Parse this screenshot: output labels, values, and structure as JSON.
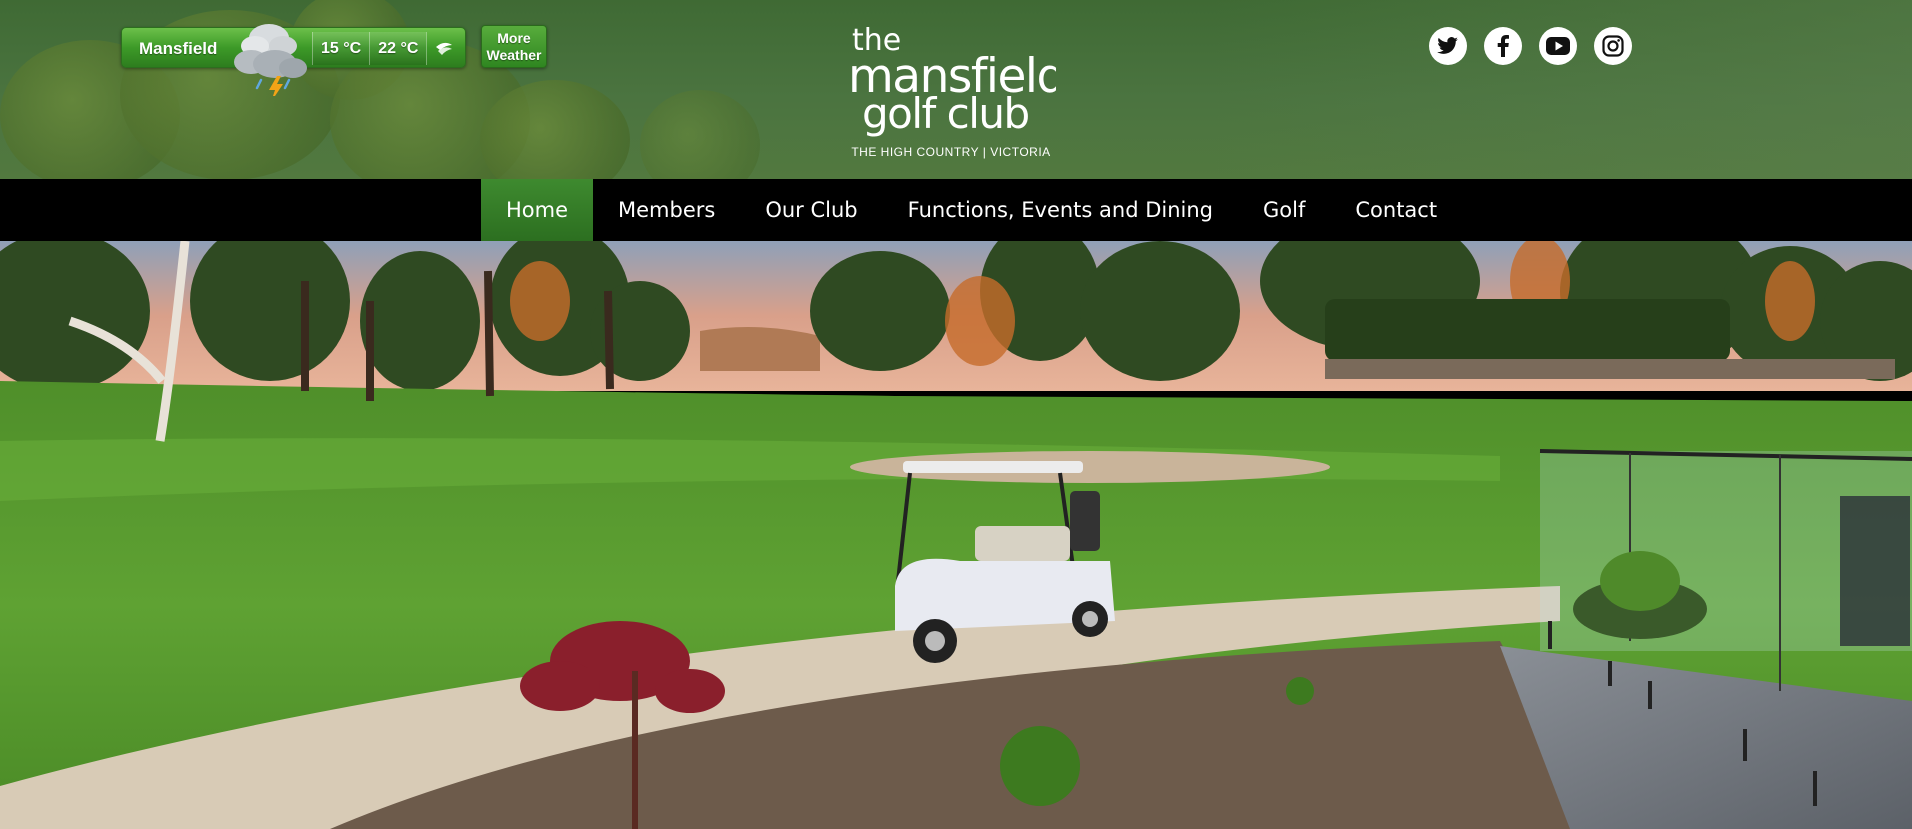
{
  "weather": {
    "location": "Mansfield",
    "min_temp": "15 °C",
    "max_temp": "22 °C",
    "condition_icon": "storm-cloud-icon",
    "more_label_line1": "More",
    "more_label_line2": "Weather"
  },
  "logo": {
    "line1": "the",
    "line2": "mansfield",
    "line3": "golf club",
    "tagline": "THE HIGH COUNTRY | VICTORIA"
  },
  "social": [
    {
      "icon": "twitter-icon"
    },
    {
      "icon": "facebook-icon"
    },
    {
      "icon": "youtube-icon"
    },
    {
      "icon": "instagram-icon"
    }
  ],
  "nav": {
    "items": [
      {
        "label": "Home",
        "active": true
      },
      {
        "label": "Members",
        "active": false
      },
      {
        "label": "Our Club",
        "active": false
      },
      {
        "label": "Functions, Events and Dining",
        "active": false
      },
      {
        "label": "Golf",
        "active": false
      },
      {
        "label": "Contact",
        "active": false
      }
    ]
  },
  "colors": {
    "header_green": "#4b7440",
    "nav_active": "#3e8a2f",
    "nav_bg": "#000000",
    "fairway": "#5a9a2f"
  }
}
